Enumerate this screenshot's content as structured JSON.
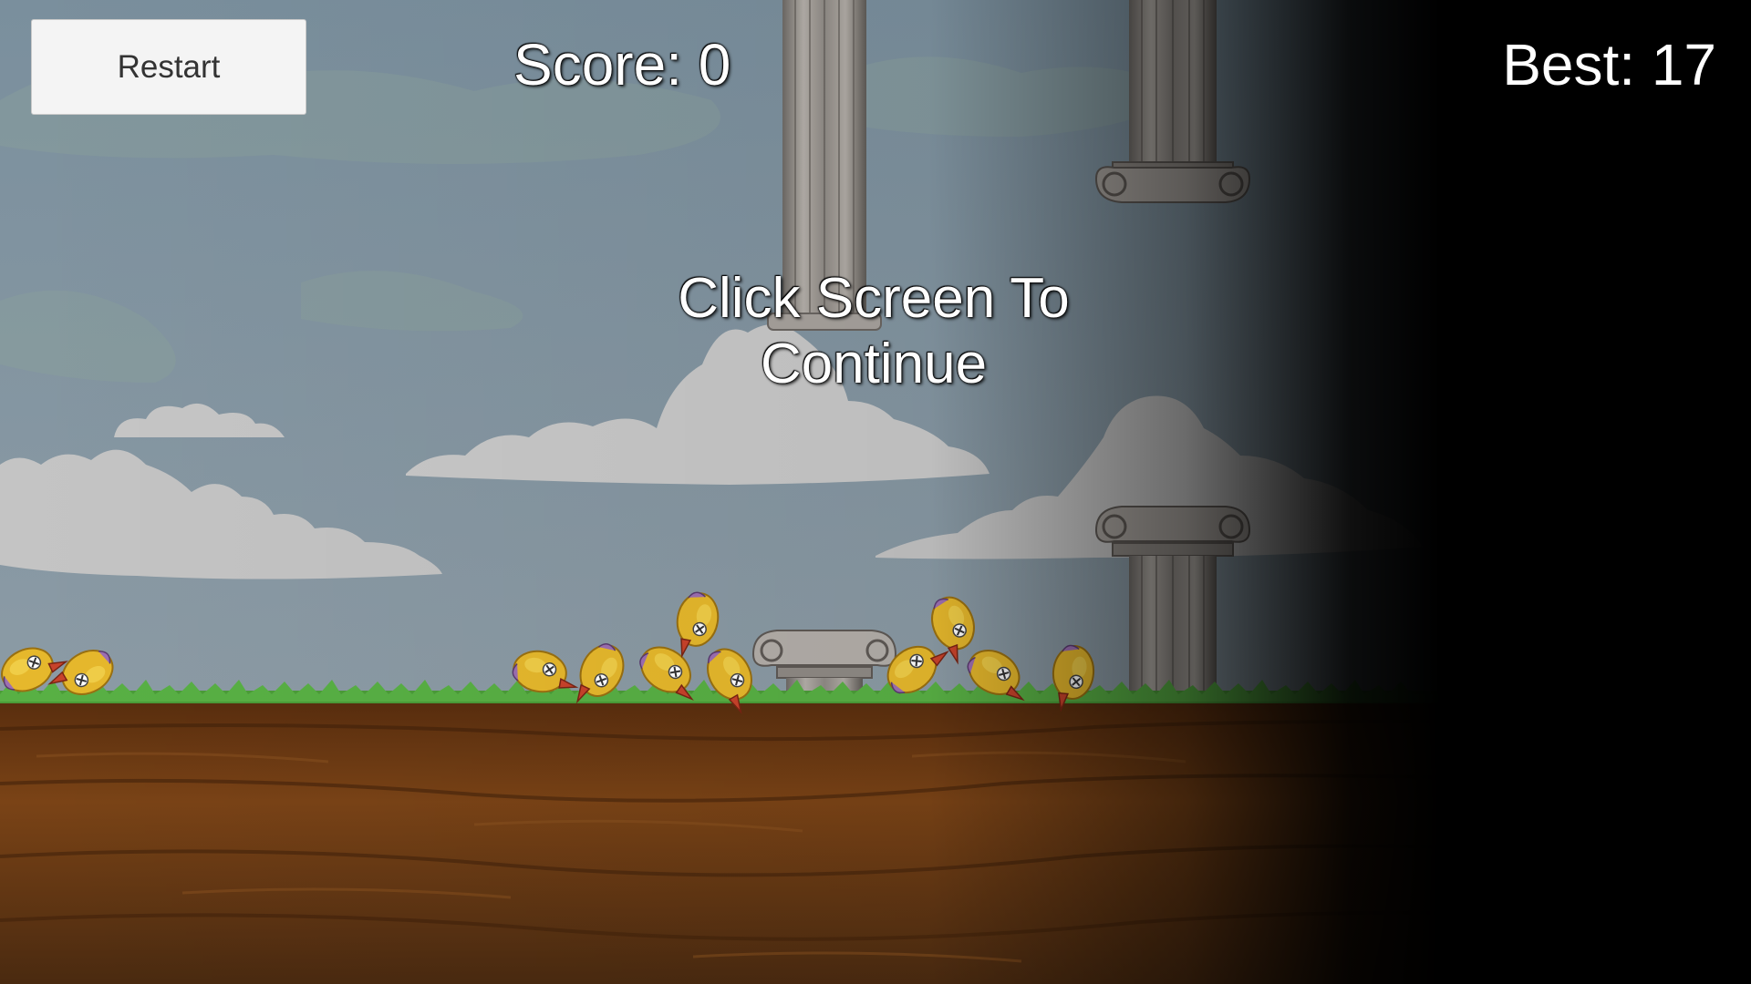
{
  "hud": {
    "restart_label": "Restart",
    "score_label": "Score: 0",
    "best_label": "Best: 17"
  },
  "overlay": {
    "prompt_line1": "Click Screen To",
    "prompt_line2": "Continue"
  },
  "colors": {
    "sky": "#7a909e",
    "cloud": "#c9c9c9",
    "grass": "#4a9e3a",
    "dirt": "#6b3a14",
    "pillar": "#9a9590",
    "bird": "#e8bb2c"
  },
  "icons": {
    "pillar": "ionic-column",
    "bird": "knocked-out-bird",
    "cloud": "cloud"
  }
}
